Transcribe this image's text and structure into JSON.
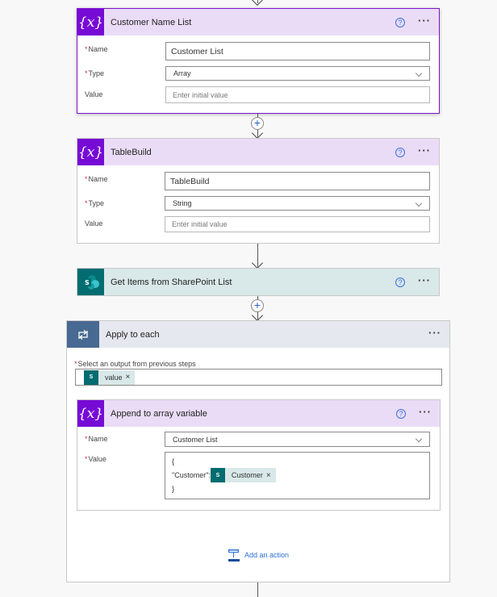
{
  "canvas": {
    "colors": {
      "variable_accent": "#770bd6",
      "variable_header": "#eadcf6",
      "sharepoint_accent": "#036c70",
      "sharepoint_header": "#d9e8e8",
      "loop_accent": "#486991",
      "loop_header": "#e5e8ef",
      "link": "#2f6fd8",
      "required": "#c4314b"
    }
  },
  "steps": {
    "customer_name_list": {
      "title": "Customer Name List",
      "icon": "variable-icon",
      "icon_text": "{x}",
      "fields": {
        "name": {
          "label": "Name",
          "required": "*",
          "value": "Customer List"
        },
        "type": {
          "label": "Type",
          "required": "*",
          "value": "Array"
        },
        "value": {
          "label": "Value",
          "placeholder": "Enter initial value"
        }
      }
    },
    "table_build": {
      "title": "TableBuild",
      "icon": "variable-icon",
      "icon_text": "{x}",
      "fields": {
        "name": {
          "label": "Name",
          "required": "*",
          "value": "TableBuild"
        },
        "type": {
          "label": "Type",
          "required": "*",
          "value": "String"
        },
        "value": {
          "label": "Value",
          "placeholder": "Enter initial value"
        }
      }
    },
    "get_items": {
      "title": "Get Items from SharePoint List",
      "icon": "sharepoint-icon",
      "icon_text": "S"
    },
    "apply_to_each": {
      "title": "Apply to each",
      "icon": "loop-icon",
      "select_label": "Select an output from previous steps",
      "required": "*",
      "token": {
        "label": "value",
        "remove": "×",
        "icon_text": "S"
      },
      "append": {
        "title": "Append to array variable",
        "icon_text": "{x}",
        "fields": {
          "name": {
            "label": "Name",
            "required": "*",
            "value": "Customer List"
          },
          "value": {
            "label": "Value",
            "required": "*",
            "line1": "{",
            "line2_prefix": "\"Customer\":",
            "line3": "}",
            "token": {
              "label": "Customer",
              "remove": "×",
              "icon_text": "S"
            }
          }
        }
      },
      "add_action": "Add an action"
    }
  },
  "common": {
    "help": "?",
    "more": "···",
    "plus": "+"
  }
}
